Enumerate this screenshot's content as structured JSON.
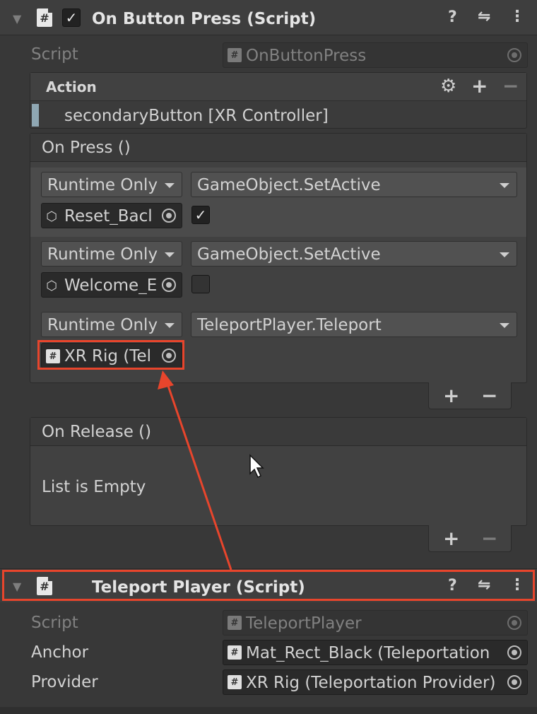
{
  "component1": {
    "title": "On Button Press (Script)",
    "enabled": true,
    "script_label": "Script",
    "script_value": "OnButtonPress",
    "action": {
      "label": "Action",
      "binding": "secondaryButton [XR Controller]"
    },
    "on_press": {
      "header": "On Press ()",
      "entries": [
        {
          "mode": "Runtime Only",
          "function": "GameObject.SetActive",
          "target": "Reset_Bacl",
          "checked": true
        },
        {
          "mode": "Runtime Only",
          "function": "GameObject.SetActive",
          "target": "Welcome_E",
          "checked": false
        },
        {
          "mode": "Runtime Only",
          "function": "TeleportPlayer.Teleport",
          "target": "XR Rig (Tel"
        }
      ]
    },
    "on_release": {
      "header": "On Release ()",
      "empty_text": "List is Empty"
    }
  },
  "component2": {
    "title": "Teleport Player (Script)",
    "script_label": "Script",
    "script_value": "TeleportPlayer",
    "anchor_label": "Anchor",
    "anchor_value": "Mat_Rect_Black (Teleportation",
    "provider_label": "Provider",
    "provider_value": "XR Rig (Teleportation Provider)"
  },
  "icons": {
    "help": "?",
    "presets": "⇋",
    "menu": "⋮",
    "gear": "⚙",
    "plus": "+",
    "minus": "−",
    "fold": "▼",
    "check": "✓",
    "cube": "⬡",
    "hash": "#"
  },
  "colors": {
    "highlight": "#e8452c",
    "background": "#383838",
    "header": "#3e3e3e"
  }
}
